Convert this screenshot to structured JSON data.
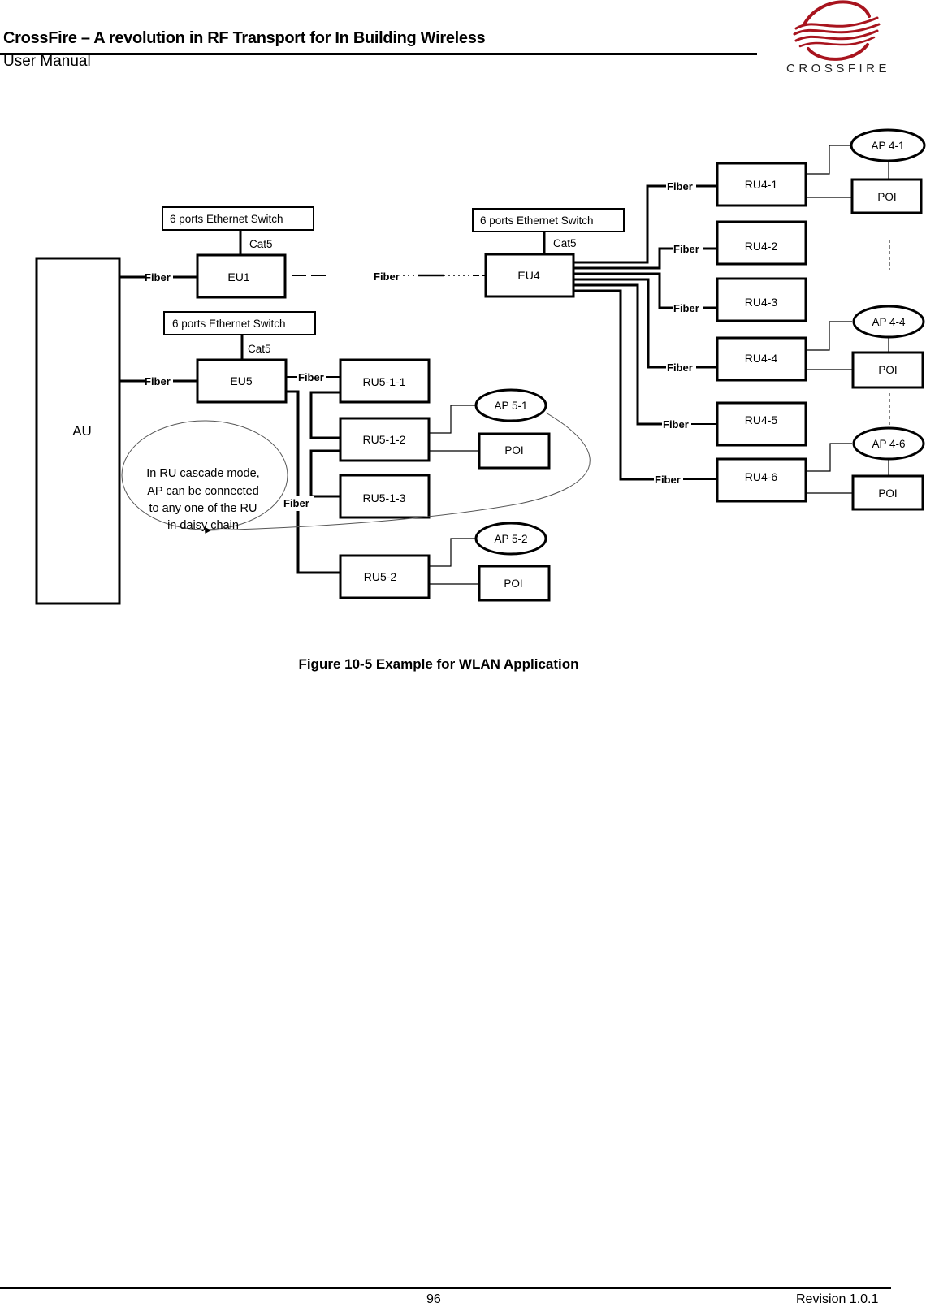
{
  "header": {
    "title": "CrossFire – A revolution in RF Transport for In Building Wireless",
    "subtitle": "User Manual",
    "logo_text": "CROSSFIRE",
    "logo_color": "#a8141e"
  },
  "diagram": {
    "au": "AU",
    "switches": {
      "eu1": "6 ports Ethernet Switch",
      "eu4": "6 ports Ethernet Switch",
      "eu5": "6 ports Ethernet Switch"
    },
    "cat5_label": "Cat5",
    "fiber_label": "Fiber",
    "extension_units": {
      "eu1": "EU1",
      "eu4": "EU4",
      "eu5": "EU5"
    },
    "ru4": [
      "RU4-1",
      "RU4-2",
      "RU4-3",
      "RU4-4",
      "RU4-5",
      "RU4-6"
    ],
    "ap4": {
      "ap41": "AP 4-1",
      "ap44": "AP 4-4",
      "ap46": "AP 4-6"
    },
    "ru5_cascade": [
      "RU5-1-1",
      "RU5-1-2",
      "RU5-1-3"
    ],
    "ru52": "RU5-2",
    "ap5": {
      "ap51": "AP 5-1",
      "ap52": "AP 5-2"
    },
    "poi_label": "POI",
    "note_lines": [
      "In RU cascade mode,",
      "AP can be connected",
      "to any one of the  RU",
      "in daisy chain"
    ]
  },
  "caption": "Figure 10-5 Example for WLAN Application",
  "footer": {
    "page_number": "96",
    "revision": "Revision 1.0.1"
  }
}
